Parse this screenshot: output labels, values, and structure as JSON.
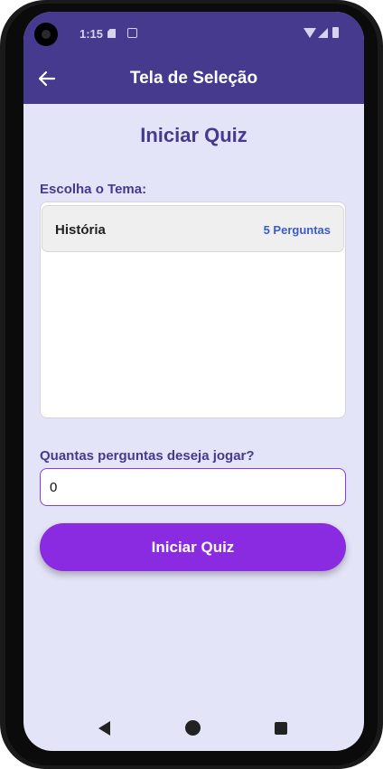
{
  "status_bar": {
    "time": "1:15",
    "icons": [
      "sd-card-icon",
      "screen-icon",
      "wifi-icon",
      "signal-icon",
      "battery-icon"
    ]
  },
  "app_bar": {
    "title": "Tela de Seleção",
    "back_icon": "arrow-left-icon",
    "background": "#463a8e"
  },
  "main": {
    "title": "Iniciar Quiz",
    "theme_label": "Escolha o Tema:",
    "topics": [
      {
        "name": "História",
        "count": "5 Perguntas"
      }
    ],
    "question_count_label": "Quantas perguntas deseja jogar?",
    "question_count_value": "0",
    "start_button_label": "Iniciar Quiz",
    "accent": "#8a2be2"
  },
  "nav_bar": {
    "icons": [
      "back-triangle-icon",
      "home-circle-icon",
      "recents-square-icon"
    ]
  }
}
